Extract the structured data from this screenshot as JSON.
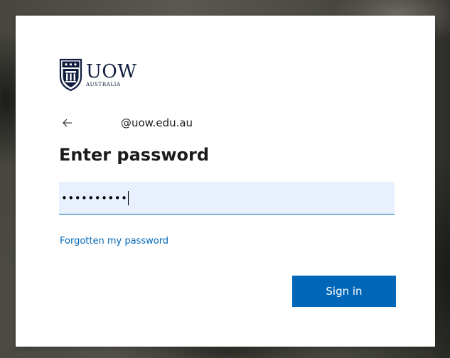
{
  "logo": {
    "name": "UOW",
    "subtitle": "AUSTRALIA"
  },
  "identity": {
    "email": "@uow.edu.au",
    "back_icon": "arrow-left-icon"
  },
  "title": "Enter password",
  "password": {
    "masked_value": "••••••••••",
    "field_color": "#e8f0fe"
  },
  "links": {
    "forgot": "Forgotten my password"
  },
  "buttons": {
    "signin": "Sign in"
  },
  "colors": {
    "accent": "#0067b8",
    "brand_navy": "#0f1c3f"
  }
}
